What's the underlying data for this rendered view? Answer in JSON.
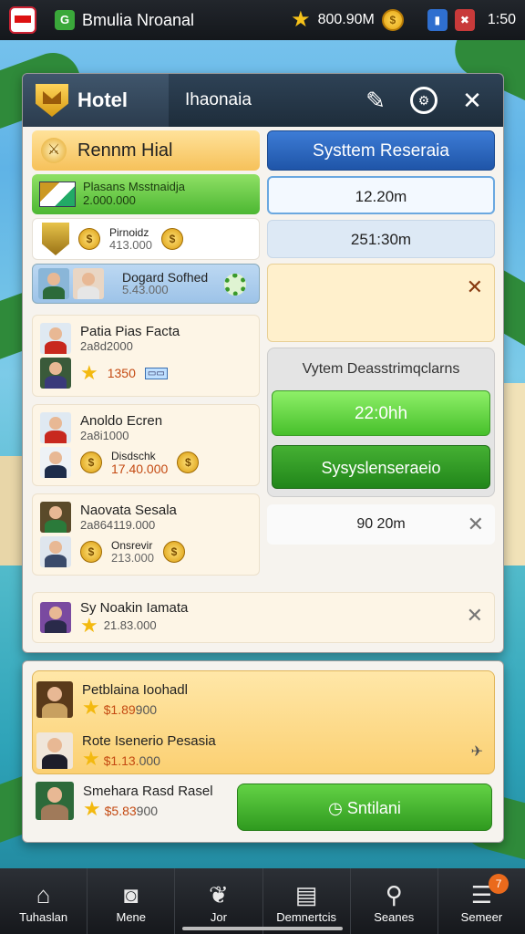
{
  "status_bar": {
    "app_title": "Bmulia Nroanal",
    "currency_value": "800.90M",
    "time": "1:50"
  },
  "window": {
    "title": "Hotel",
    "subtitle": "Ihaonaia"
  },
  "left": {
    "header_label": "Rennm Hial",
    "green_card": {
      "line1": "Plasans Msstnaidja",
      "line2": "2.000.000"
    },
    "white_card": {
      "label": "Pirnoidz",
      "value": "413.000"
    },
    "blue_card": {
      "label": "Dogard Sofhed",
      "value": "5.43.000"
    },
    "persons": [
      {
        "name": "Patia Pias Facta",
        "value": "2a8d2000",
        "price": "1350"
      },
      {
        "name": "Anoldo Ecren",
        "value": "2a8i1000",
        "sub": "Disdschk",
        "price": "17.40.000"
      },
      {
        "name": "Naovata Sesala",
        "value": "2a864119.000",
        "sub": "Onsrevir",
        "price": "213.000"
      },
      {
        "name": "Sy Noakin Iamata",
        "value": "21.83.000"
      }
    ]
  },
  "right": {
    "button_top": "Systtem Reseraia",
    "time1": "12.20m",
    "time2": "251:30m",
    "panel_title": "Vytem Deasstrimqclarns",
    "time3": "22:0hh",
    "button_mid": "Sysyslenseraeio",
    "time4": "90 20m"
  },
  "bonus": {
    "items": [
      {
        "name": "Petblaina Ioohadl",
        "price": "$1.89",
        "tail": "900"
      },
      {
        "name": "Rote Isenerio Pesasia",
        "price": "$1.13.",
        "tail": "000"
      },
      {
        "name": "Smehara Rasd Rasel",
        "price": "$5.83",
        "tail": "900"
      }
    ],
    "start_label": "Sntilani"
  },
  "nav": [
    {
      "label": "Tuhaslan",
      "icon": "home-icon"
    },
    {
      "label": "Mene",
      "icon": "camera-icon"
    },
    {
      "label": "Jor",
      "icon": "wings-icon"
    },
    {
      "label": "Demnertcis",
      "icon": "stack-icon"
    },
    {
      "label": "Seanes",
      "icon": "search-icon"
    },
    {
      "label": "Semeer",
      "icon": "list-icon",
      "badge": "7"
    }
  ],
  "colors": {
    "accent_green": "#47c02b",
    "accent_blue": "#1f55a8",
    "header_dark": "#1e2d3b"
  }
}
